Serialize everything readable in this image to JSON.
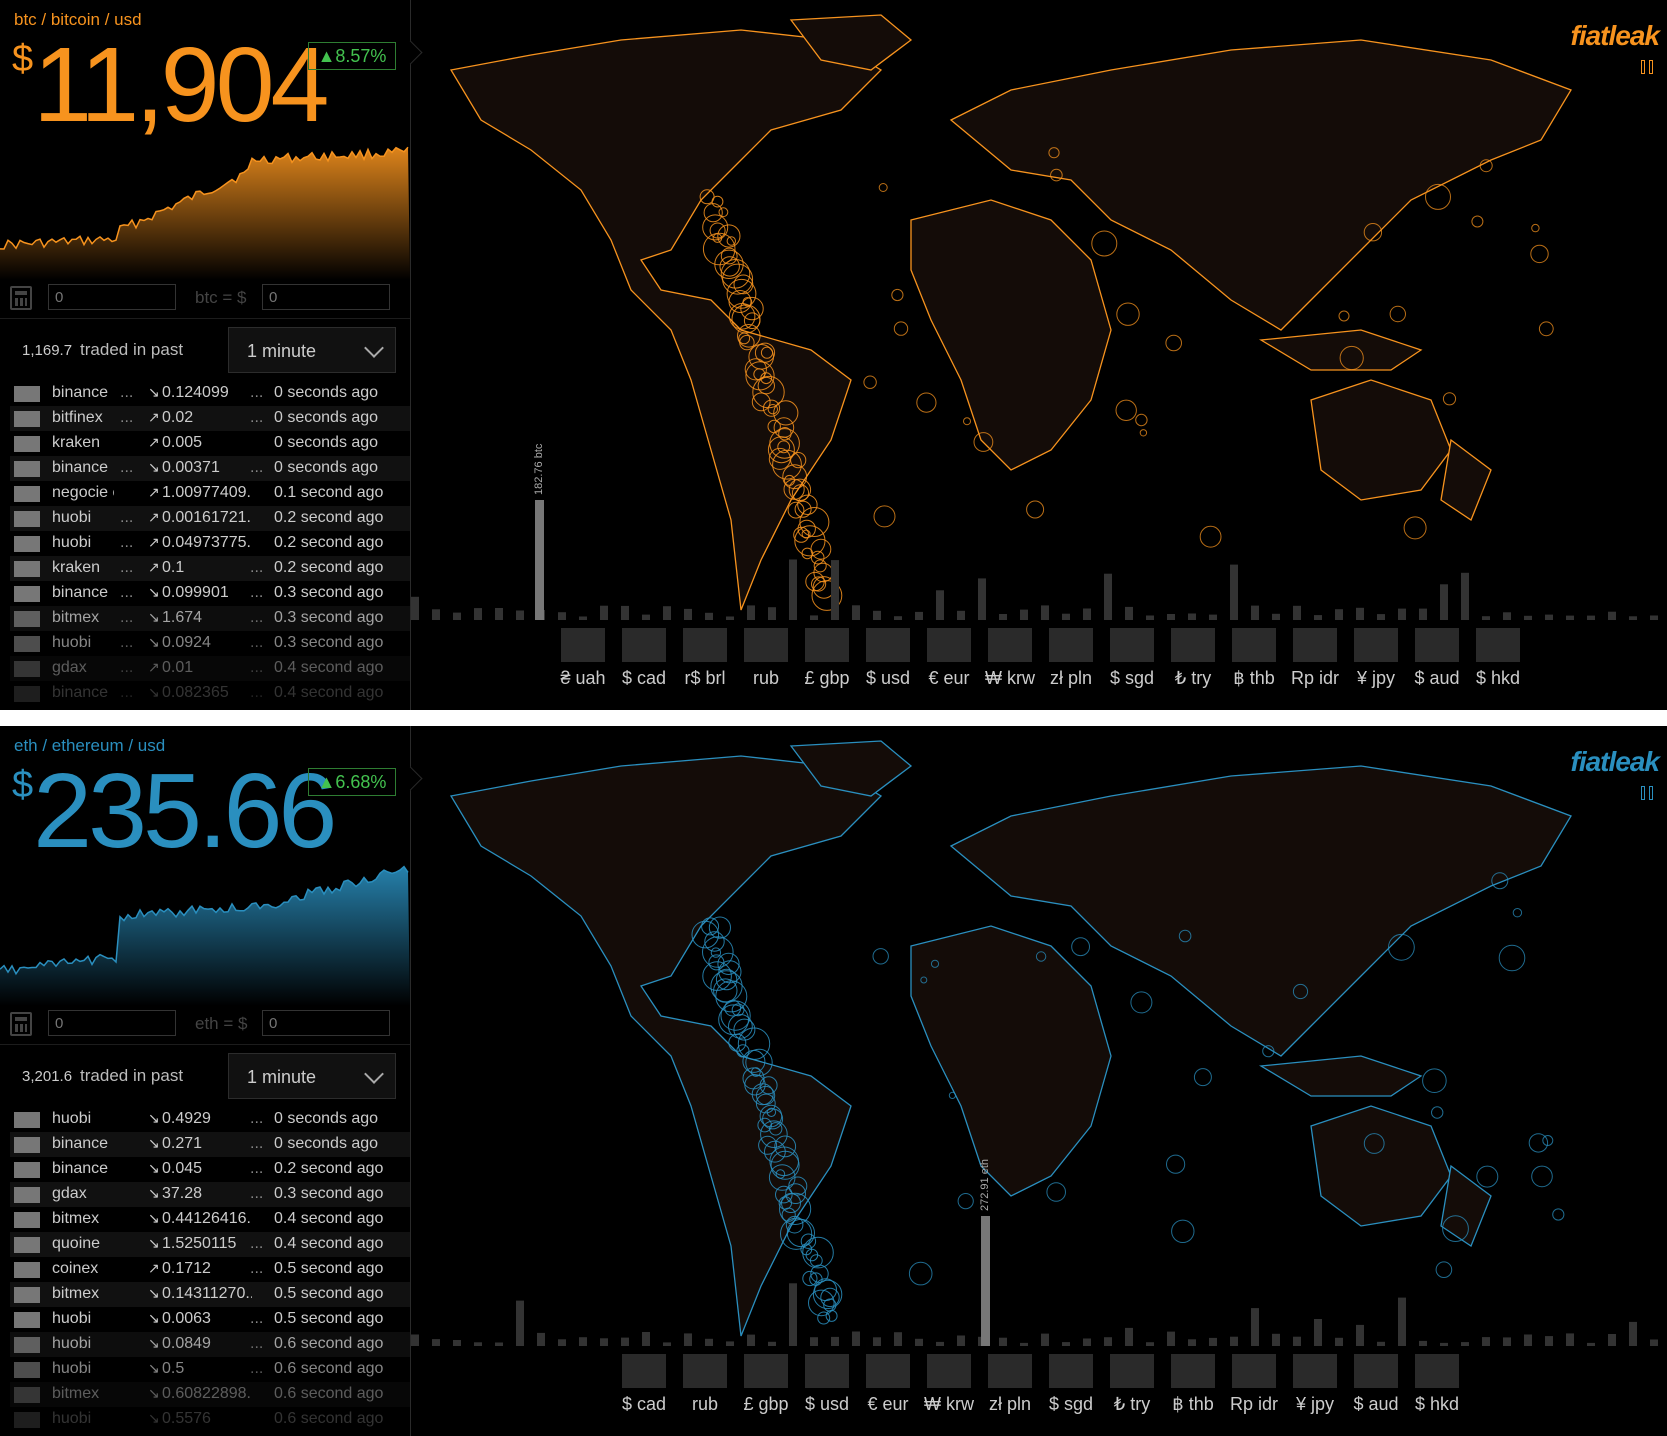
{
  "panels": [
    {
      "id": "btc",
      "pair": "btc / bitcoin / usd",
      "currency_symbol": "$",
      "price": "11,904",
      "change": "▲8.57%",
      "accent": "#f7931e",
      "calc_label": "btc = $",
      "calc_placeholder": "0",
      "traded_amount": "1,169.7",
      "traded_label": "traded in past",
      "period": "1 minute",
      "volume_label": "182.76 btc",
      "trades": [
        {
          "exchange": "binance",
          "dots1": "...",
          "dir": "down",
          "amount": "0.124099",
          "dots2": "...",
          "ago": "0 seconds ago",
          "fade": 1.0
        },
        {
          "exchange": "bitfinex",
          "dots1": "...",
          "dir": "up",
          "amount": "0.02",
          "dots2": "...",
          "ago": "0 seconds ago",
          "fade": 1.0
        },
        {
          "exchange": "kraken",
          "dots1": "",
          "dir": "up",
          "amount": "0.005",
          "dots2": "",
          "ago": "0 seconds ago",
          "fade": 1.0
        },
        {
          "exchange": "binance",
          "dots1": "...",
          "dir": "down",
          "amount": "0.00371",
          "dots2": "...",
          "ago": "0 seconds ago",
          "fade": 1.0
        },
        {
          "exchange": "negocie c...",
          "dots1": "",
          "dir": "up",
          "amount": "1.00977409...",
          "dots2": "",
          "ago": "0.1 second ago",
          "fade": 1.0
        },
        {
          "exchange": "huobi",
          "dots1": "...",
          "dir": "up",
          "amount": "0.00161721...",
          "dots2": "",
          "ago": "0.2 second ago",
          "fade": 1.0
        },
        {
          "exchange": "huobi",
          "dots1": "...",
          "dir": "up",
          "amount": "0.04973775...",
          "dots2": "",
          "ago": "0.2 second ago",
          "fade": 1.0
        },
        {
          "exchange": "kraken",
          "dots1": "...",
          "dir": "up",
          "amount": "0.1",
          "dots2": "...",
          "ago": "0.2 second ago",
          "fade": 1.0
        },
        {
          "exchange": "binance",
          "dots1": "...",
          "dir": "down",
          "amount": "0.099901",
          "dots2": "...",
          "ago": "0.3 second ago",
          "fade": 1.0
        },
        {
          "exchange": "bitmex",
          "dots1": "...",
          "dir": "down",
          "amount": "1.674",
          "dots2": "...",
          "ago": "0.3 second ago",
          "fade": 0.8
        },
        {
          "exchange": "huobi",
          "dots1": "...",
          "dir": "down",
          "amount": "0.0924",
          "dots2": "...",
          "ago": "0.3 second ago",
          "fade": 0.65
        },
        {
          "exchange": "gdax",
          "dots1": "...",
          "dir": "up",
          "amount": "0.01",
          "dots2": "...",
          "ago": "0.4 second ago",
          "fade": 0.45
        },
        {
          "exchange": "binance",
          "dots1": "...",
          "dir": "down",
          "amount": "0.082365",
          "dots2": "...",
          "ago": "0.4 second ago",
          "fade": 0.25
        }
      ],
      "currencies": [
        {
          "label": "₴ uah",
          "icon": "flag-ua-icon"
        },
        {
          "label": "$ cad",
          "icon": "flag-ca-icon"
        },
        {
          "label": "r$ brl",
          "icon": "flag-br-icon"
        },
        {
          "label": "rub",
          "icon": "flag-ru-icon"
        },
        {
          "label": "£ gbp",
          "icon": "flag-gb-icon"
        },
        {
          "label": "$ usd",
          "icon": "flag-us-icon"
        },
        {
          "label": "€ eur",
          "icon": "flag-eu-icon"
        },
        {
          "label": "₩ krw",
          "icon": "flag-kr-icon"
        },
        {
          "label": "zł pln",
          "icon": "flag-pl-icon"
        },
        {
          "label": "$ sgd",
          "icon": "flag-sg-icon"
        },
        {
          "label": "₺ try",
          "icon": "flag-tr-icon"
        },
        {
          "label": "฿ thb",
          "icon": "flag-th-icon"
        },
        {
          "label": "Rp idr",
          "icon": "flag-id-icon"
        },
        {
          "label": "¥ jpy",
          "icon": "flag-jp-icon"
        },
        {
          "label": "$ aud",
          "icon": "flag-au-icon"
        },
        {
          "label": "$ hkd",
          "icon": "flag-hk-icon"
        }
      ],
      "logo": "fiatleak"
    },
    {
      "id": "eth",
      "pair": "eth / ethereum / usd",
      "currency_symbol": "$",
      "price": "235.66",
      "change": "▲6.68%",
      "accent": "#2a8fbf",
      "calc_label": "eth = $",
      "calc_placeholder": "0",
      "traded_amount": "3,201.6",
      "traded_label": "traded in past",
      "period": "1 minute",
      "volume_label": "272.91 eth",
      "trades": [
        {
          "exchange": "huobi",
          "dots1": "",
          "dir": "down",
          "amount": "0.4929",
          "dots2": "...",
          "ago": "0 seconds ago",
          "fade": 1.0
        },
        {
          "exchange": "binance",
          "dots1": "",
          "dir": "down",
          "amount": "0.271",
          "dots2": "...",
          "ago": "0 seconds ago",
          "fade": 1.0
        },
        {
          "exchange": "binance",
          "dots1": "",
          "dir": "down",
          "amount": "0.045",
          "dots2": "...",
          "ago": "0.2 second ago",
          "fade": 1.0
        },
        {
          "exchange": "gdax",
          "dots1": "",
          "dir": "down",
          "amount": "37.28",
          "dots2": "...",
          "ago": "0.3 second ago",
          "fade": 1.0
        },
        {
          "exchange": "bitmex",
          "dots1": "",
          "dir": "down",
          "amount": "0.44126416...",
          "dots2": "",
          "ago": "0.4 second ago",
          "fade": 1.0
        },
        {
          "exchange": "quoine",
          "dots1": "",
          "dir": "down",
          "amount": "1.5250115",
          "dots2": "...",
          "ago": "0.4 second ago",
          "fade": 1.0
        },
        {
          "exchange": "coinex",
          "dots1": "",
          "dir": "up",
          "amount": "0.1712",
          "dots2": "...",
          "ago": "0.5 second ago",
          "fade": 1.0
        },
        {
          "exchange": "bitmex",
          "dots1": "",
          "dir": "down",
          "amount": "0.14311270...",
          "dots2": "",
          "ago": "0.5 second ago",
          "fade": 1.0
        },
        {
          "exchange": "huobi",
          "dots1": "",
          "dir": "down",
          "amount": "0.0063",
          "dots2": "...",
          "ago": "0.5 second ago",
          "fade": 1.0
        },
        {
          "exchange": "huobi",
          "dots1": "",
          "dir": "down",
          "amount": "0.0849",
          "dots2": "...",
          "ago": "0.6 second ago",
          "fade": 0.8
        },
        {
          "exchange": "huobi",
          "dots1": "",
          "dir": "down",
          "amount": "0.5",
          "dots2": "...",
          "ago": "0.6 second ago",
          "fade": 0.65
        },
        {
          "exchange": "bitmex",
          "dots1": "",
          "dir": "down",
          "amount": "0.60822898...",
          "dots2": "",
          "ago": "0.6 second ago",
          "fade": 0.45
        },
        {
          "exchange": "huobi",
          "dots1": "",
          "dir": "down",
          "amount": "0.5576",
          "dots2": "",
          "ago": "0.6 second ago",
          "fade": 0.25
        }
      ],
      "currencies": [
        {
          "label": "$ cad",
          "icon": "flag-ca-icon"
        },
        {
          "label": "rub",
          "icon": "flag-ru-icon"
        },
        {
          "label": "£ gbp",
          "icon": "flag-gb-icon"
        },
        {
          "label": "$ usd",
          "icon": "flag-us-icon"
        },
        {
          "label": "€ eur",
          "icon": "flag-eu-icon"
        },
        {
          "label": "₩ krw",
          "icon": "flag-kr-icon"
        },
        {
          "label": "zł pln",
          "icon": "flag-pl-icon"
        },
        {
          "label": "$ sgd",
          "icon": "flag-sg-icon"
        },
        {
          "label": "₺ try",
          "icon": "flag-tr-icon"
        },
        {
          "label": "฿ thb",
          "icon": "flag-th-icon"
        },
        {
          "label": "Rp idr",
          "icon": "flag-id-icon"
        },
        {
          "label": "¥ jpy",
          "icon": "flag-jp-icon"
        },
        {
          "label": "$ aud",
          "icon": "flag-au-icon"
        },
        {
          "label": "$ hkd",
          "icon": "flag-hk-icon"
        }
      ],
      "logo": "fiatleak"
    }
  ]
}
